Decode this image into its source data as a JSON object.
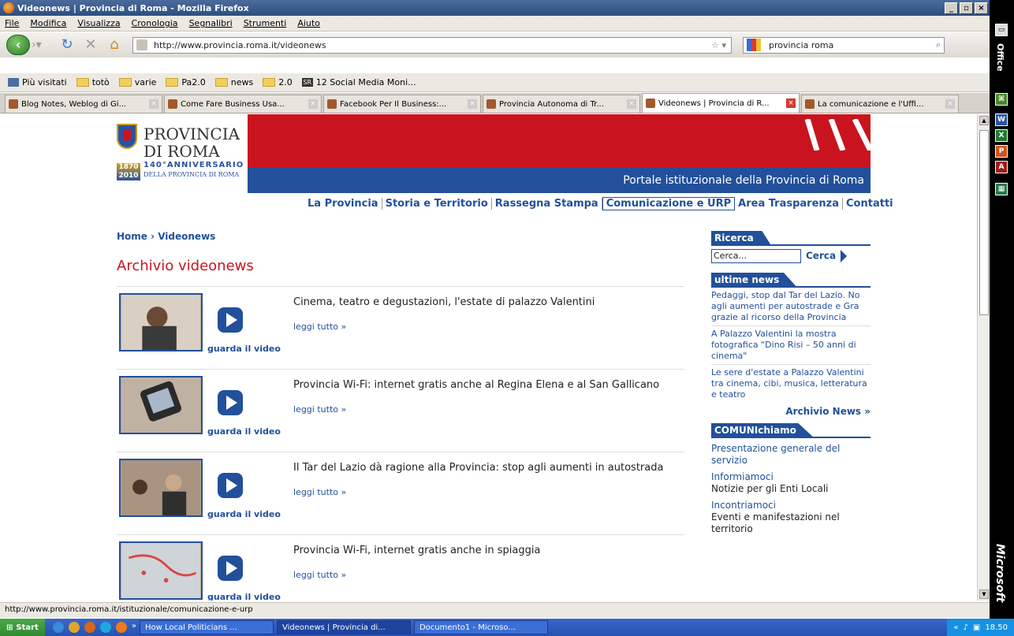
{
  "window": {
    "title": "Videonews | Provincia di Roma - Mozilla Firefox",
    "min": "_",
    "max": "▫",
    "close": "×"
  },
  "menu": [
    "File",
    "Modifica",
    "Visualizza",
    "Cronologia",
    "Segnalibri",
    "Strumenti",
    "Aiuto"
  ],
  "toolbar": {
    "url": "http://www.provincia.roma.it/videonews",
    "search_value": "provincia roma",
    "back_icon": "back-arrow-icon",
    "reload_icon": "reload-icon",
    "stop_icon": "stop-icon",
    "home_icon": "home-icon"
  },
  "bookmarks": [
    "Più visitati",
    "totò",
    "varie",
    "Pa2.0",
    "news",
    "2.0",
    "12 Social Media Moni..."
  ],
  "tabs": [
    {
      "label": "Blog Notes, Weblog di Gi...",
      "active": false
    },
    {
      "label": "Come Fare Business Usa...",
      "active": false
    },
    {
      "label": "Facebook Per Il Business:...",
      "active": false
    },
    {
      "label": "Provincia Autonoma di Tr...",
      "active": false
    },
    {
      "label": "Videonews | Provincia di R...",
      "active": true
    },
    {
      "label": "La comunicazione e l'Uffi...",
      "active": false
    }
  ],
  "page": {
    "logo": {
      "line1": "PROVINCIA",
      "line2": "DI ROMA",
      "anniv": "140°ANNIVERSARIO",
      "anniv_sub": "DELLA PROVINCIA DI ROMA",
      "years": "1870 2010"
    },
    "portal_label": "Portale istituzionale della Provincia di Roma",
    "nav": [
      "La Provincia",
      "Storia e Territorio",
      "Rassegna Stampa",
      "Comunicazione e URP",
      "Area Trasparenza",
      "Contatti"
    ],
    "breadcrumb": "Home › Videonews",
    "title": "Archivio videonews",
    "videos": [
      {
        "title": "Cinema, teatro e degustazioni, l'estate di palazzo Valentini",
        "more": "leggi tutto »",
        "watch": "guarda il video"
      },
      {
        "title": "Provincia Wi-Fi: internet gratis anche al Regina Elena e al San Gallicano",
        "more": "leggi tutto »",
        "watch": "guarda il video"
      },
      {
        "title": "Il Tar del Lazio dà ragione alla Provincia: stop agli aumenti in autostrada",
        "more": "leggi tutto »",
        "watch": "guarda il video"
      },
      {
        "title": "Provincia Wi-Fi, internet gratis anche in spiaggia",
        "more": "leggi tutto »",
        "watch": "guarda il video"
      }
    ],
    "sidebar": {
      "search_heading": "Ricerca",
      "search_placeholder": "Cerca...",
      "search_button": "Cerca",
      "news_heading": "ultime news",
      "news": [
        "Pedaggi, stop dal Tar del Lazio. No agli aumenti per autostrade e Gra grazie al ricorso della Provincia",
        "A Palazzo Valentini la mostra fotografica \"Dino Risi – 50 anni di cinema\"",
        "Le sere d'estate a Palazzo Valentini tra cinema, cibi, musica, letteratura e teatro"
      ],
      "news_archive": "Archivio News »",
      "comuni_heading": "COMUNIchiamo",
      "comuni": [
        {
          "link": "Presentazione generale del servizio",
          "text": ""
        },
        {
          "link": "Informiamoci",
          "text": "Notizie per gli Enti Locali"
        },
        {
          "link": "Incontriamoci",
          "text": "Eventi e manifestazioni nel territorio"
        }
      ]
    }
  },
  "status": "http://www.provincia.roma.it/istituzionale/comunicazione-e-urp",
  "taskbar": {
    "start": "Start",
    "tasks": [
      "How Local Politicians ...",
      "Videonews | Provincia di...",
      "Documento1 - Microso..."
    ],
    "active_task": 1,
    "clock": "18.50"
  },
  "office": {
    "label": "Office",
    "brand": "Microsoft"
  }
}
